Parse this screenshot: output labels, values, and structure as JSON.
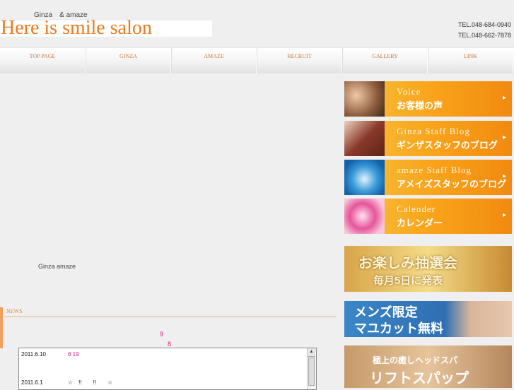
{
  "header": {
    "tagline": "Ginza　& amaze",
    "logo": "Here is smile salon",
    "tel1": "TEL.048-684-0940",
    "tel2": "TEL.048-662-7878"
  },
  "nav": [
    "TOP PAGE",
    "GINZA",
    "AMAZE",
    "RECRUIT",
    "GALLERY",
    "LINK"
  ],
  "main": {
    "text": "Ginza amaze"
  },
  "news": {
    "title": "NEWS",
    "pink1": "9",
    "pink2": "8",
    "rows": [
      {
        "date": "2011.6.10",
        "text": "6 19"
      },
      {
        "date": "2011.6.1",
        "text": "☆　!!　　!!　　☆"
      }
    ]
  },
  "sidebar": {
    "banners": [
      {
        "en": "Voice",
        "jp": "お客様の声"
      },
      {
        "en": "Ginza Staff Blog",
        "jp": "ギンザスタッフのブログ"
      },
      {
        "en": "amaze Staff Blog",
        "jp": "アメイズスタッフのブログ"
      },
      {
        "en": "Calender",
        "jp": "カレンダー"
      }
    ],
    "promos": [
      {
        "line1": "お楽しみ抽選会",
        "line2": "毎月5日に発表"
      },
      {
        "line1": "メンズ限定",
        "line2": "マユカット無料"
      },
      {
        "line1": "極上の癒しヘッドスパ",
        "line2": "リフトスパップ"
      }
    ]
  }
}
